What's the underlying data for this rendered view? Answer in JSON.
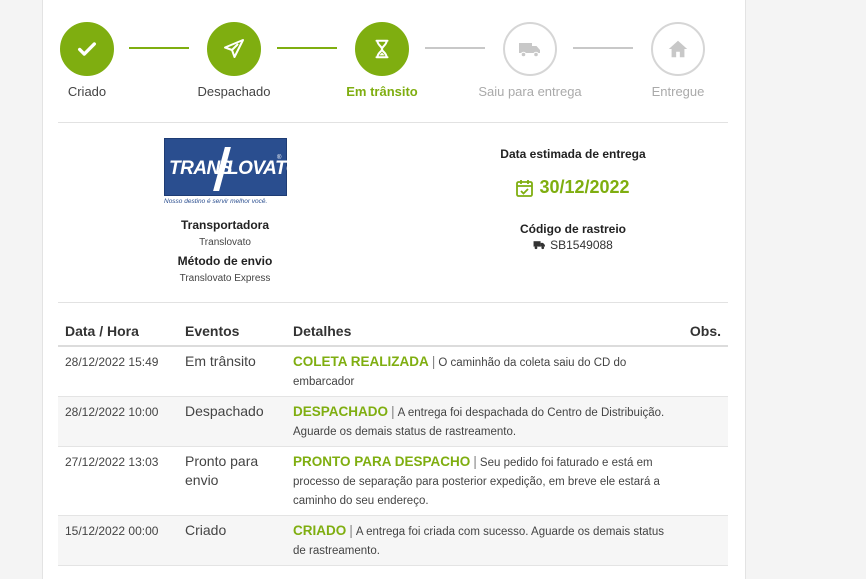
{
  "stepper": {
    "steps": [
      {
        "label": "Criado",
        "state": "done",
        "icon": "check-icon"
      },
      {
        "label": "Despachado",
        "state": "done",
        "icon": "paper-plane-icon"
      },
      {
        "label": "Em trânsito",
        "state": "active",
        "icon": "hourglass-icon"
      },
      {
        "label": "Saiu para entrega",
        "state": "pending",
        "icon": "truck-icon"
      },
      {
        "label": "Entregue",
        "state": "pending",
        "icon": "home-icon"
      }
    ]
  },
  "carrier": {
    "logo_text_left": "TRANS",
    "logo_text_right": "LOVATO",
    "logo_tagline": "Nosso destino é servir melhor você.",
    "title_label": "Transportadora",
    "name": "Translovato",
    "method_label": "Método de envio",
    "method": "Translovato Express"
  },
  "delivery": {
    "estimate_label": "Data estimada de entrega",
    "estimate_date": "30/12/2022",
    "tracking_label": "Código de rastreio",
    "tracking_code": "SB1549088"
  },
  "table": {
    "headers": {
      "date": "Data / Hora",
      "event": "Eventos",
      "details": "Detalhes",
      "obs": "Obs."
    },
    "rows": [
      {
        "date": "28/12/2022 15:49",
        "event": "Em trânsito",
        "status": "COLETA REALIZADA",
        "detail": "O caminhão da coleta saiu do CD do embarcador",
        "obs": ""
      },
      {
        "date": "28/12/2022 10:00",
        "event": "Despachado",
        "status": "DESPACHADO",
        "detail": "A entrega foi despachada do Centro de Distribuição. Aguarde os demais status de rastreamento.",
        "obs": ""
      },
      {
        "date": "27/12/2022 13:03",
        "event": "Pronto para envio",
        "status": "PRONTO PARA DESPACHO",
        "detail": "Seu pedido foi faturado e está em processo de separação para posterior expedição, em breve ele estará a caminho do seu endereço.",
        "obs": ""
      },
      {
        "date": "15/12/2022 00:00",
        "event": "Criado",
        "status": "CRIADO",
        "detail": "A entrega foi criada com sucesso. Aguarde os demais status de rastreamento.",
        "obs": ""
      }
    ]
  },
  "colors": {
    "accent": "#7fae10",
    "pending": "#d6d6d6",
    "logo_blue": "#2a4e8f"
  }
}
